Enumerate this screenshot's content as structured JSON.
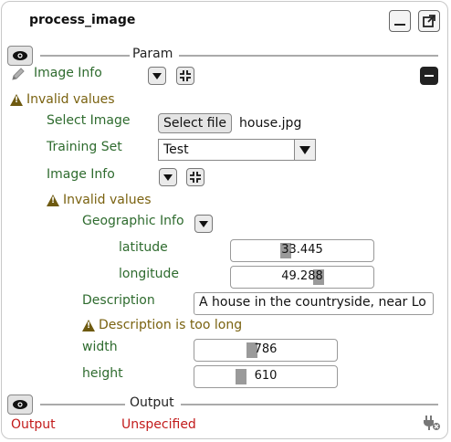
{
  "node": {
    "title": "process_image"
  },
  "param_section": {
    "title": "Param",
    "image_info_label": "Image Info",
    "warning": "Invalid values",
    "fields": {
      "select_image_label": "Select Image",
      "select_file_button": "Select file",
      "file_name": "house.jpg",
      "training_set_label": "Training Set",
      "training_set_value": "Test",
      "image_info_label": "Image Info",
      "inner_warning": "Invalid values",
      "geographic_info_label": "Geographic Info",
      "latitude_label": "latitude",
      "latitude_value": "33.445",
      "longitude_label": "longitude",
      "longitude_value": "49.288",
      "description_label": "Description",
      "description_value": "A house in the countryside, near Lo",
      "description_warning": "Description is too long",
      "width_label": "width",
      "width_value": "786",
      "height_label": "height",
      "height_value": "610"
    }
  },
  "output_section": {
    "title": "Output",
    "name": "Output",
    "type": "Unspecified"
  },
  "icons": [
    "eye-icon",
    "minimize-icon",
    "external-link-icon",
    "pencil-icon",
    "chevron-down-icon",
    "compress-icon",
    "minus-icon",
    "warning-icon",
    "plug-disconnect-icon"
  ],
  "colors": {
    "label_green": "#2e6b2e",
    "warning_olive": "#7a6210",
    "output_red": "#c21b1b"
  }
}
